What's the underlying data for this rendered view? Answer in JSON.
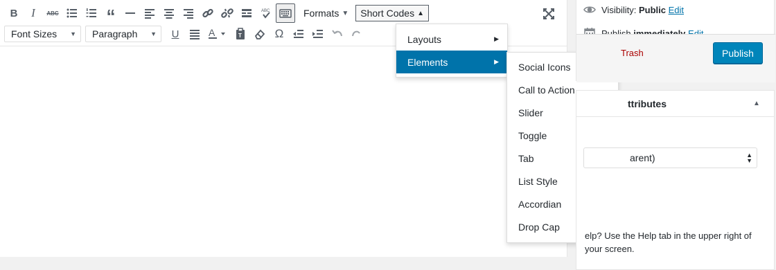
{
  "toolbar": {
    "formats_label": "Formats",
    "shortcodes_label": "Short Codes",
    "font_sizes_label": "Font Sizes",
    "paragraph_label": "Paragraph"
  },
  "shortcodes_menu": {
    "items": [
      {
        "label": "Layouts"
      },
      {
        "label": "Elements"
      }
    ]
  },
  "elements_menu": {
    "items": [
      {
        "label": "Social Icons"
      },
      {
        "label": "Call to Action"
      },
      {
        "label": "Slider"
      },
      {
        "label": "Toggle"
      },
      {
        "label": "Tab"
      },
      {
        "label": "List Style"
      },
      {
        "label": "Accordian"
      },
      {
        "label": "Drop Cap"
      }
    ]
  },
  "publish": {
    "visibility_label": "Visibility:",
    "visibility_value": "Public",
    "visibility_edit": "Edit",
    "publish_label": "Publish",
    "publish_value": "immediately",
    "publish_edit": "Edit",
    "trash_label": "Trash",
    "publish_button": "Publish"
  },
  "attributes": {
    "title_partial": "ttributes",
    "parent_partial": "arent)",
    "help_partial": "elp? Use the Help tab in the upper right of your screen."
  },
  "colors": {
    "accent": "#0073aa",
    "publish_button": "#0085ba",
    "trash": "#a00"
  }
}
